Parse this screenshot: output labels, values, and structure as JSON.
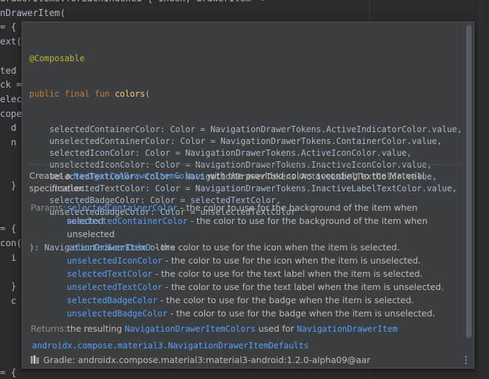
{
  "editor": {
    "lines": [
      "drawerItems.forEachIndexed { index, drawerItem ->",
      "nDrawerItem(",
      "= {",
      "ext(",
      "",
      "ted",
      "ck =",
      "elec",
      "cope",
      "  d",
      "  n",
      "",
      "",
      "  }",
      "",
      "",
      "= {",
      "con(",
      "  i",
      "",
      "  }",
      "  c",
      "",
      "",
      "",
      "",
      "= {"
    ]
  },
  "popup": {
    "signature": {
      "annotation": "@Composable",
      "keywords": "public final fun",
      "function": "colors",
      "open": "(",
      "params": [
        "    selectedContainerColor: Color = NavigationDrawerTokens.ActiveIndicatorColor.value,",
        "    unselectedContainerColor: Color = NavigationDrawerTokens.ContainerColor.value,",
        "    selectedIconColor: Color = NavigationDrawerTokens.ActiveIconColor.value,",
        "    unselectedIconColor: Color = NavigationDrawerTokens.InactiveIconColor.value,",
        "    selectedTextColor: Color = NavigationDrawerTokens.ActiveLabelTextColor.value,",
        "    unselectedTextColor: Color = NavigationDrawerTokens.InactiveLabelTextColor.value,",
        "    selectedBadgeColor: Color = selectedTextColor,",
        "    unselectedBadgeColor: Color = unselectedTextColor"
      ],
      "close": "): NavigationDrawerItemColors"
    },
    "description": {
      "prefix": "Creates a ",
      "link": "NavigationDrawerItemColors",
      "suffix": " with the provided colors according to the Material",
      "line2": "specification."
    },
    "params_label": "Params:",
    "params": [
      {
        "name": "selectedContainerColor",
        "desc": " - the color to use for the background of the item when selected"
      },
      {
        "name": "unselectedContainerColor",
        "desc": " - the color to use for the background of the item when",
        "desc2": "unselected"
      },
      {
        "name": "selectedIconColor",
        "desc": " - the color to use for the icon when the item is selected."
      },
      {
        "name": "unselectedIconColor",
        "desc": " - the color to use for the icon when the item is unselected."
      },
      {
        "name": "selectedTextColor",
        "desc": " - the color to use for the text label when the item is selected."
      },
      {
        "name": "unselectedTextColor",
        "desc": " - the color to use for the text label when the item is unselected."
      },
      {
        "name": "selectedBadgeColor",
        "desc": " - the color to use for the badge when the item is selected."
      },
      {
        "name": "unselectedBadgeColor",
        "desc": " - the color to use for the badge when the item is unselected."
      }
    ],
    "returns_label": "Returns:",
    "returns": {
      "prefix": "the resulting ",
      "link1": "NavigationDrawerItemColors",
      "mid": " used for ",
      "link2": "NavigationDrawerItem"
    },
    "defaults_link": "androidx.compose.material3.NavigationDrawerItemDefaults",
    "footer": {
      "gradle_text": "Gradle: androidx.compose.material3:material3-android:1.2.0-alpha09@aar",
      "more_icon": "⋮"
    }
  }
}
